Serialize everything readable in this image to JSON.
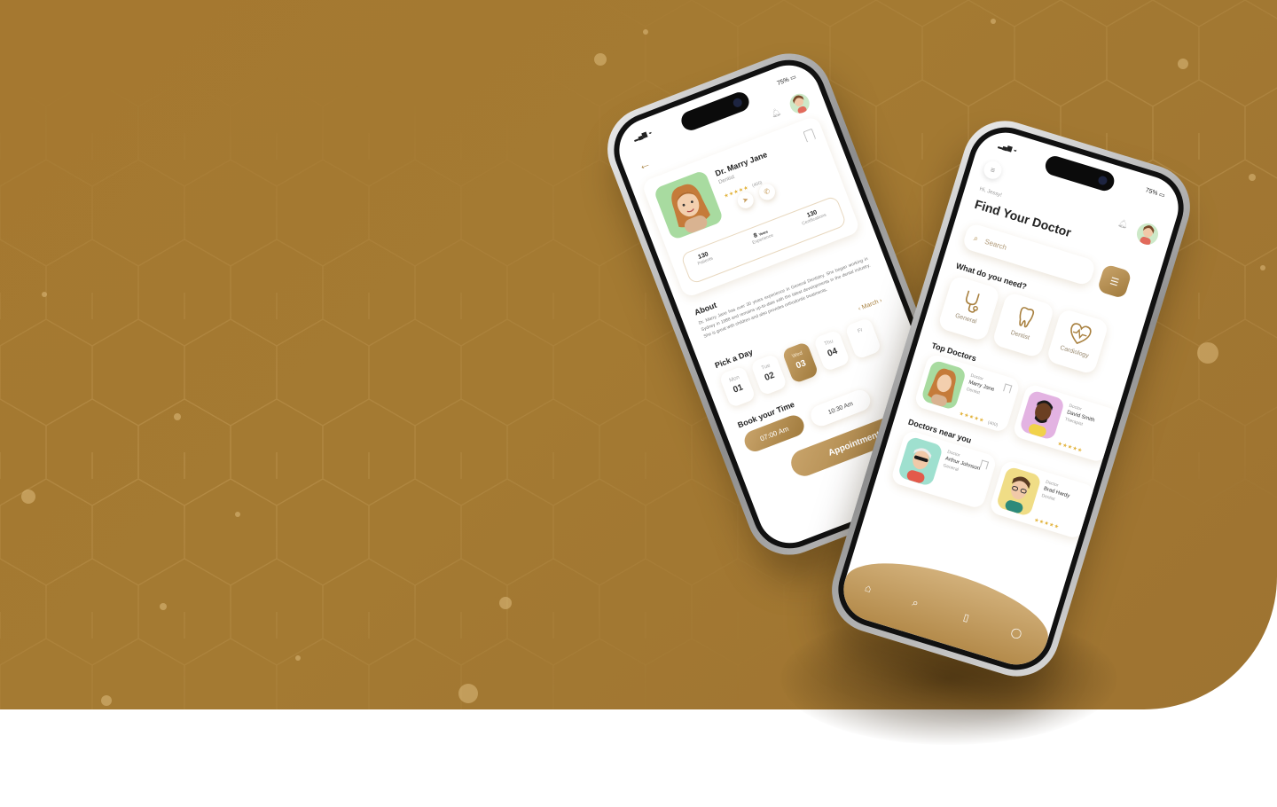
{
  "colors": {
    "banner": "#a57830",
    "accent": "#a8803f",
    "accent_light": "#c9a46b",
    "white": "#ffffff"
  },
  "detail_screen": {
    "battery": "75%",
    "doctor_name": "Dr. Marry Jane",
    "doctor_role": "Dentist",
    "rating_count": "(400)",
    "stats": [
      {
        "value": "130",
        "label": "Patients"
      },
      {
        "value": "8",
        "unit": "Years",
        "label": "Experience"
      },
      {
        "value": "130",
        "label": "Certifications"
      }
    ],
    "about_title": "About",
    "about_text": "Dr. Marry Jane has over 30 years experience in General Dentistry. She began working in Sydney in 1988 and remains up-to-date with the latest developments in the dental industry. She is great with children and also provides orthodontic treatments.",
    "pick_day_title": "Pick a Day",
    "month": "March",
    "days": [
      {
        "name": "Mon",
        "num": "01"
      },
      {
        "name": "Tue",
        "num": "02"
      },
      {
        "name": "Wed",
        "num": "03"
      },
      {
        "name": "Thu",
        "num": "04"
      },
      {
        "name": "Fr",
        "num": ""
      }
    ],
    "book_time_title": "Book your Time",
    "times": [
      "07:00 Am",
      "10:30 Am"
    ],
    "appointment_button": "Appointment"
  },
  "home_screen": {
    "battery": "75%",
    "greeting": "Hi, Jessy!",
    "heading": "Find Your Doctor",
    "search_placeholder": "Search",
    "need_title": "What do you need?",
    "services": [
      "General",
      "Dentist",
      "Cardiology"
    ],
    "top_doctors_title": "Top Doctors",
    "top_doctors": [
      {
        "tag": "Doctor",
        "name": "Marry Jane",
        "role": "Dentist",
        "rating_count": "(400)"
      },
      {
        "tag": "Doctor",
        "name": "David Smith",
        "role": "Therapist"
      }
    ],
    "near_title": "Doctors near you",
    "near_doctors": [
      {
        "tag": "Doctor",
        "name": "Arthur Johnson",
        "role": "General"
      },
      {
        "tag": "Doctor",
        "name": "Brad Hardy",
        "role": "Dentist"
      }
    ],
    "stars": "★★★★★"
  }
}
